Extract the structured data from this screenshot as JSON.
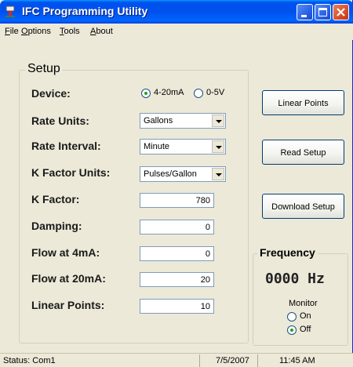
{
  "window": {
    "title": "IFC Programming Utility"
  },
  "menu": [
    {
      "u": "F",
      "rest": "ile"
    },
    {
      "u": "O",
      "rest": "ptions"
    },
    {
      "u": "T",
      "rest": "ools"
    },
    {
      "u": "A",
      "rest": "bout"
    }
  ],
  "setup": {
    "legend": "Setup",
    "device_label": "Device:",
    "device_options": [
      "4-20mA",
      "0-5V"
    ],
    "device_selected": "4-20mA",
    "rate_units_label": "Rate Units:",
    "rate_units_value": "Gallons",
    "rate_interval_label": "Rate Interval:",
    "rate_interval_value": "Minute",
    "k_factor_units_label": "K Factor Units:",
    "k_factor_units_value": "Pulses/Gallon",
    "k_factor_label": "K Factor:",
    "k_factor_value": "780",
    "damping_label": "Damping:",
    "damping_value": "0",
    "flow_4ma_label": "Flow at 4mA:",
    "flow_4ma_value": "0",
    "flow_20ma_label": "Flow at 20mA:",
    "flow_20ma_value": "20",
    "linear_points_label": "Linear Points:",
    "linear_points_value": "10"
  },
  "buttons": {
    "linear_points": "Linear Points",
    "read_setup": "Read Setup",
    "download_setup": "Download Setup"
  },
  "frequency": {
    "legend": "Frequency",
    "value": "0000 Hz",
    "monitor_label": "Monitor",
    "monitor_options": [
      "On",
      "Off"
    ],
    "monitor_selected": "Off"
  },
  "status": {
    "text": "Status:  Com1",
    "date": "7/5/2007",
    "time": "11:45 AM"
  },
  "colors": {
    "titlebar": "#0053ee",
    "window_bg": "#ece9d8",
    "radio_dot": "#21a121"
  }
}
